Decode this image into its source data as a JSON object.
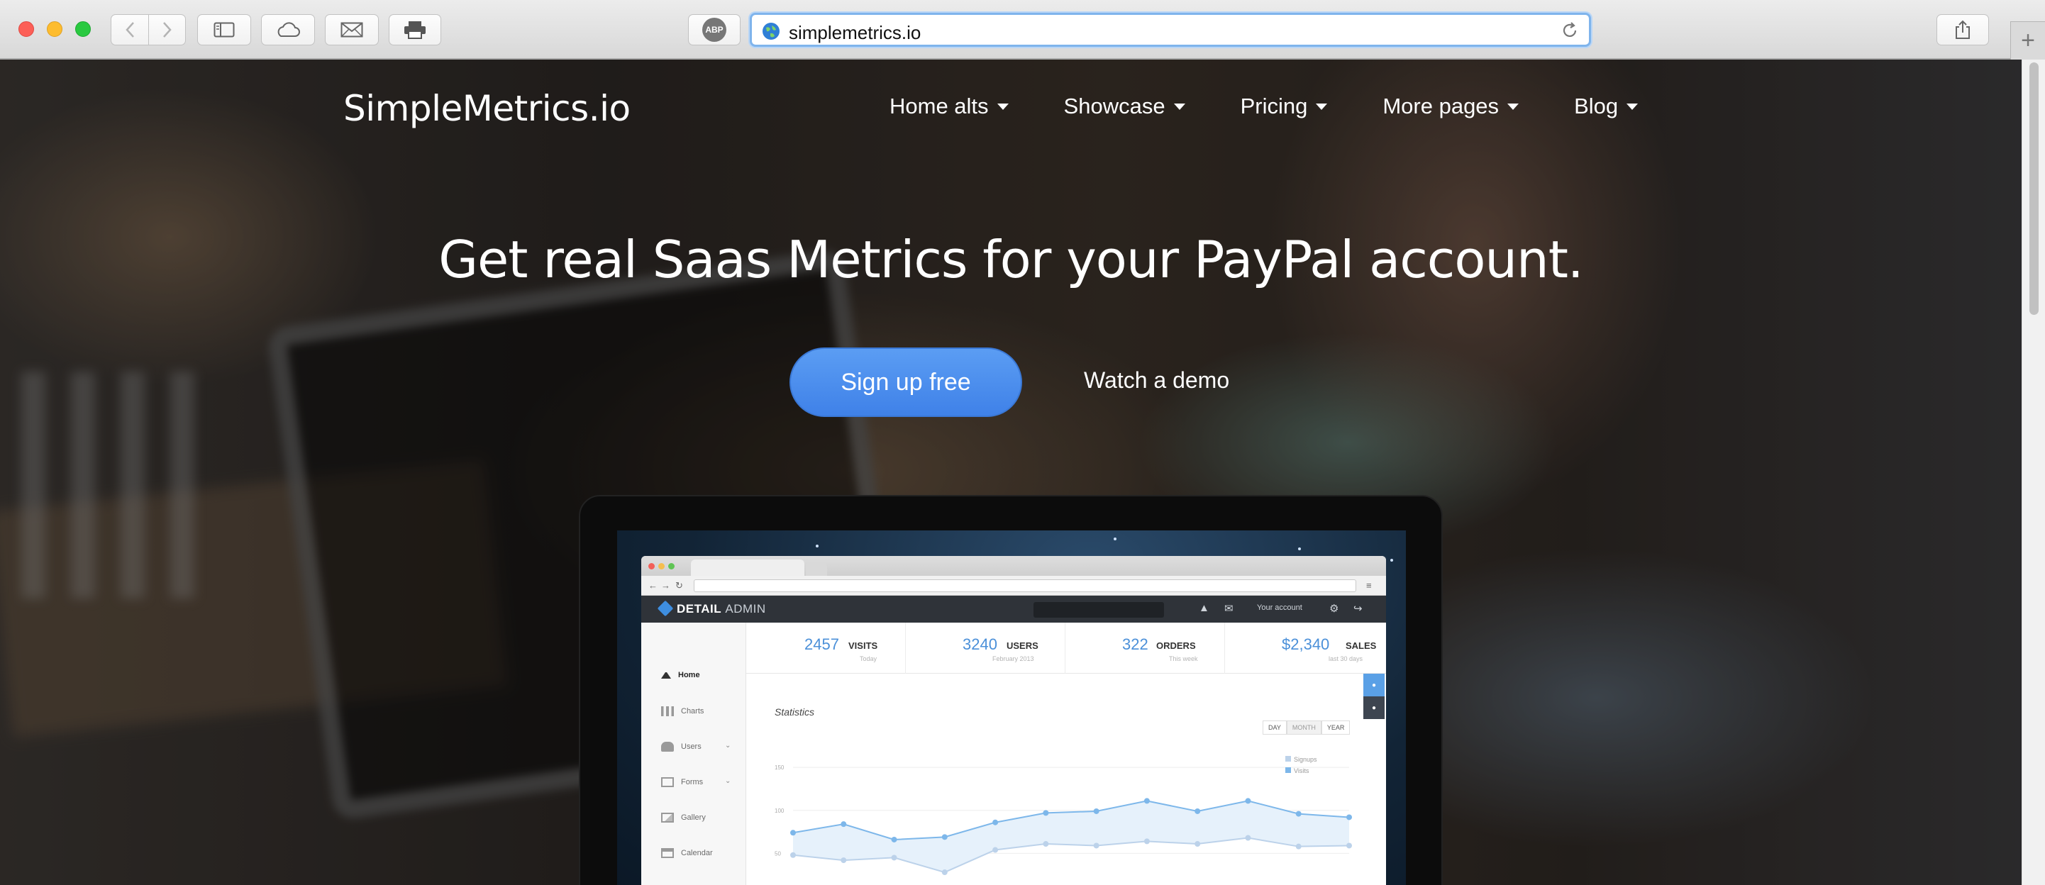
{
  "browser": {
    "url": "simplemetrics.io",
    "adblock_label": "ABP"
  },
  "site": {
    "brand": "SimpleMetrics.io",
    "nav": [
      {
        "label": "Home alts"
      },
      {
        "label": "Showcase"
      },
      {
        "label": "Pricing"
      },
      {
        "label": "More pages"
      },
      {
        "label": "Blog"
      }
    ],
    "hero_title": "Get real Saas Metrics for your PayPal account.",
    "signup_label": "Sign up free",
    "demo_label": "Watch a demo"
  },
  "mockup": {
    "app_name": "DETAIL",
    "app_name_suffix": "ADMIN",
    "account_label": "Your account",
    "sidebar": [
      {
        "label": "Home",
        "icon": "home-icon",
        "active": true,
        "has_arrow": false
      },
      {
        "label": "Charts",
        "icon": "bar-chart-icon",
        "active": false,
        "has_arrow": false
      },
      {
        "label": "Users",
        "icon": "users-icon",
        "active": false,
        "has_arrow": true
      },
      {
        "label": "Forms",
        "icon": "edit-icon",
        "active": false,
        "has_arrow": true
      },
      {
        "label": "Gallery",
        "icon": "image-icon",
        "active": false,
        "has_arrow": false
      },
      {
        "label": "Calendar",
        "icon": "calendar-icon",
        "active": false,
        "has_arrow": false
      }
    ],
    "stats": [
      {
        "value": "2457",
        "label": "VISITS",
        "sub": "Today"
      },
      {
        "value": "3240",
        "label": "USERS",
        "sub": "February 2013"
      },
      {
        "value": "322",
        "label": "ORDERS",
        "sub": "This week"
      },
      {
        "value": "$2,340",
        "label": "SALES",
        "sub": "last 30 days"
      }
    ],
    "chart_title": "Statistics",
    "range_buttons": [
      "DAY",
      "MONTH",
      "YEAR"
    ]
  },
  "chart_data": {
    "type": "area",
    "title": "Statistics",
    "ylim": [
      0,
      160
    ],
    "yticks": [
      "150",
      "100",
      "50"
    ],
    "x": [
      1,
      2,
      3,
      4,
      5,
      6,
      7,
      8,
      9,
      10,
      11,
      12
    ],
    "series": [
      {
        "name": "Signups",
        "color": "#bcd2ea",
        "values": [
          48,
          42,
          45,
          28,
          54,
          61,
          59,
          64,
          61,
          68,
          58,
          59
        ]
      },
      {
        "name": "Visits",
        "color": "#7db7ea",
        "values": [
          74,
          84,
          66,
          69,
          86,
          97,
          99,
          111,
          99,
          111,
          96,
          92
        ]
      }
    ],
    "grid": true,
    "legend_position": "top-right"
  }
}
